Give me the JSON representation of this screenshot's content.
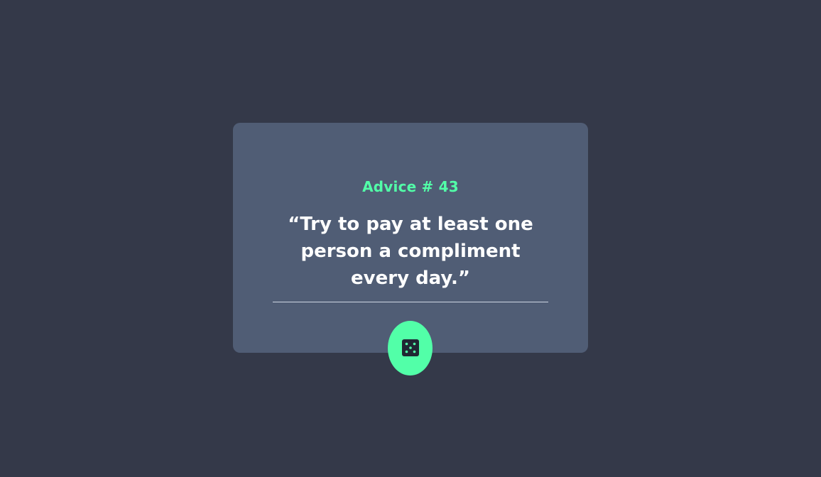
{
  "advice": {
    "id_label": "Advice # 43",
    "quote": "“Try to pay at least one person a compliment every day.”"
  },
  "colors": {
    "background": "#343949",
    "card": "#505d75",
    "accent": "#52ffa8",
    "text": "#ffffff"
  },
  "icons": {
    "dice": "dice-icon"
  }
}
